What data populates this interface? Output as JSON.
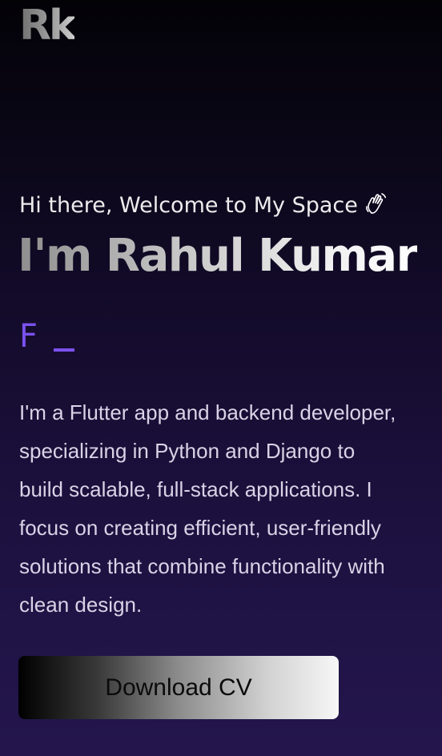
{
  "header": {
    "logo_text": "Rk"
  },
  "hero": {
    "greeting": "Hi there, Welcome to My Space",
    "greeting_icon": "waving-hand-icon",
    "name_heading": "I'm Rahul Kumar",
    "typed_text": "F",
    "accent_color": "#7a52ee",
    "bio_lines": [
      "I'm a Flutter app and backend developer,",
      "specializing in Python and Django to",
      "build scalable, full-stack applications. I",
      "focus on creating efficient, user-friendly",
      "solutions that combine functionality with",
      "clean design."
    ],
    "cv_button_label": "Download CV"
  }
}
